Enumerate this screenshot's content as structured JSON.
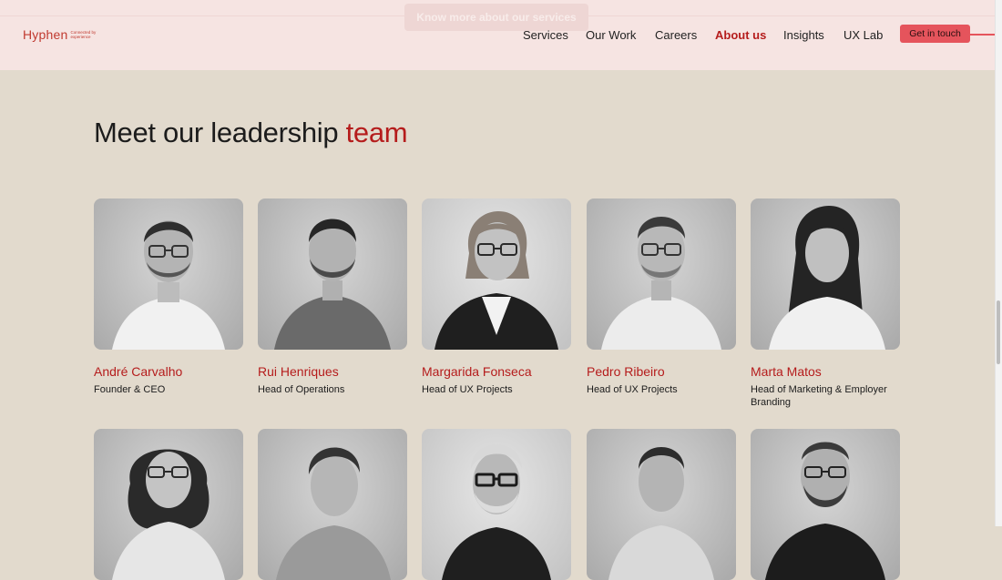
{
  "header": {
    "banner": "Know more about our services",
    "logo_word": "Hyphen",
    "logo_tagline": "Connected by experience",
    "nav": [
      "Services",
      "Our Work",
      "Careers",
      "About us",
      "Insights",
      "UX Lab"
    ],
    "active_nav": "About us",
    "cta_label": "Get in touch",
    "accent_color": "#b51c1c",
    "cta_color": "#e5545c"
  },
  "section": {
    "title_main": "Meet our leadership ",
    "title_accent": "team"
  },
  "team": [
    {
      "name": "André Carvalho",
      "role": "Founder & CEO"
    },
    {
      "name": "Rui Henriques",
      "role": "Head of Operations"
    },
    {
      "name": "Margarida Fonseca",
      "role": "Head of UX Projects"
    },
    {
      "name": "Pedro Ribeiro",
      "role": "Head of UX Projects"
    },
    {
      "name": "Marta Matos",
      "role": "Head of Marketing & Employer Branding"
    }
  ]
}
